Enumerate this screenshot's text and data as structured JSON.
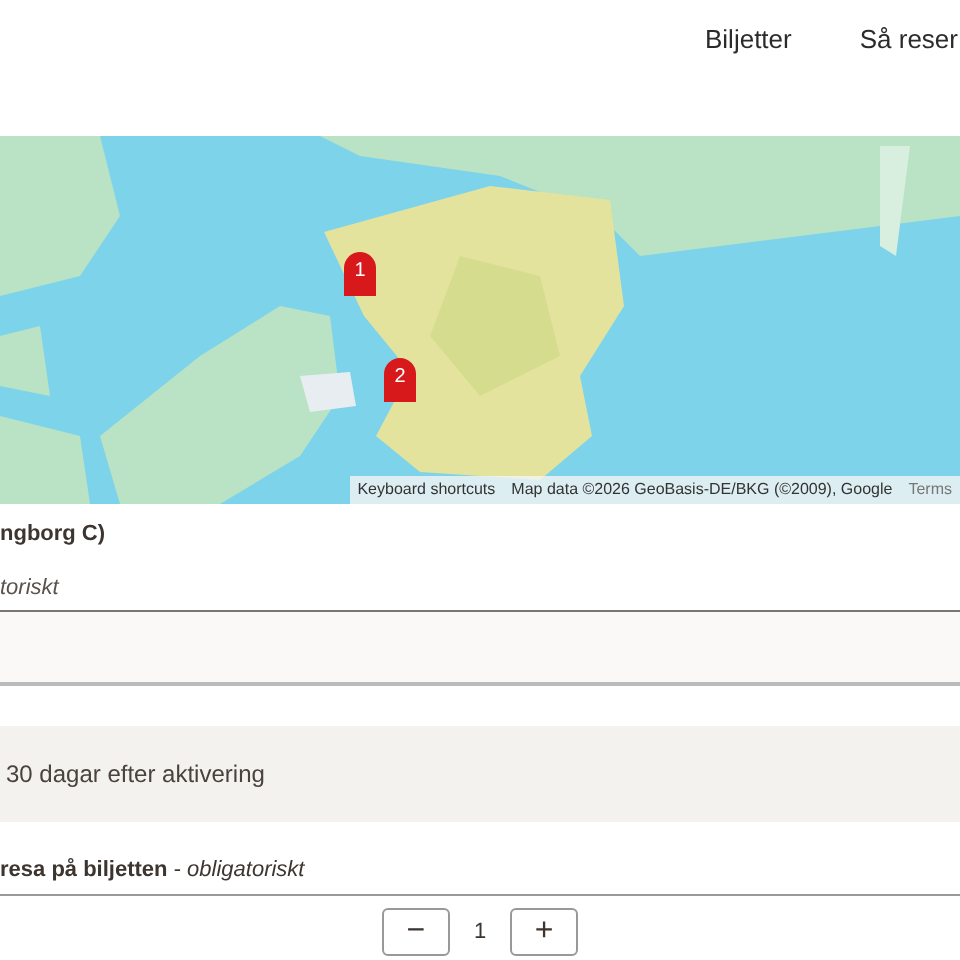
{
  "nav": {
    "items": [
      "Biljetter",
      "Så reser"
    ]
  },
  "map": {
    "kind": "picture",
    "pins": [
      "1",
      "2"
    ],
    "attribution": [
      "Keyboard shortcuts",
      "Map data ©2026 GeoBasis-DE/BKG (©2009), Google",
      "Terms"
    ]
  },
  "station": "ngborg C)",
  "field": {
    "label": "toriskt"
  },
  "info": "30 dagar efter aktivering",
  "quantity": {
    "label": "**resa på biljetten** - *obligatoriskt*",
    "value": "1",
    "decrement": "−",
    "increment": "+"
  }
}
